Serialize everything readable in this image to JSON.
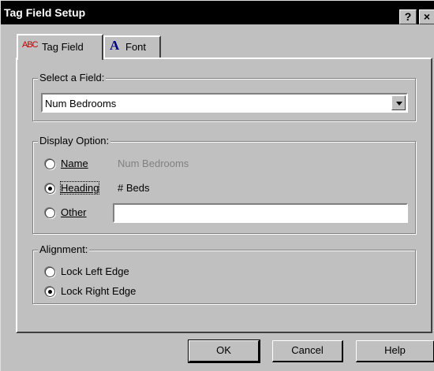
{
  "window": {
    "title": "Tag Field Setup"
  },
  "titlebar": {
    "help_label": "?",
    "close_label": "×"
  },
  "tabs": [
    {
      "label": "Tag Field",
      "icon": "abc-text-icon",
      "active": true
    },
    {
      "label": "Font",
      "icon": "font-a-icon",
      "active": false
    }
  ],
  "tab_icons": {
    "abc": "ABC",
    "font": "A"
  },
  "select_field": {
    "group_label": "Select a Field:",
    "selected": "Num Bedrooms"
  },
  "display_option": {
    "group_label": "Display Option:",
    "name_label": "Name",
    "name_value": "Num Bedrooms",
    "heading_label": "Heading",
    "heading_value": "# Beds",
    "other_label": "Other",
    "other_value": "",
    "selected": "heading"
  },
  "alignment": {
    "group_label": "Alignment:",
    "lock_left_label": "Lock Left Edge",
    "lock_right_label": "Lock Right Edge",
    "selected": "lock_right"
  },
  "buttons": {
    "ok": "OK",
    "cancel": "Cancel",
    "help": "Help"
  },
  "colors": {
    "face": "#c0c0c0",
    "titlebar": "#000000",
    "disabled_text": "#808080"
  }
}
